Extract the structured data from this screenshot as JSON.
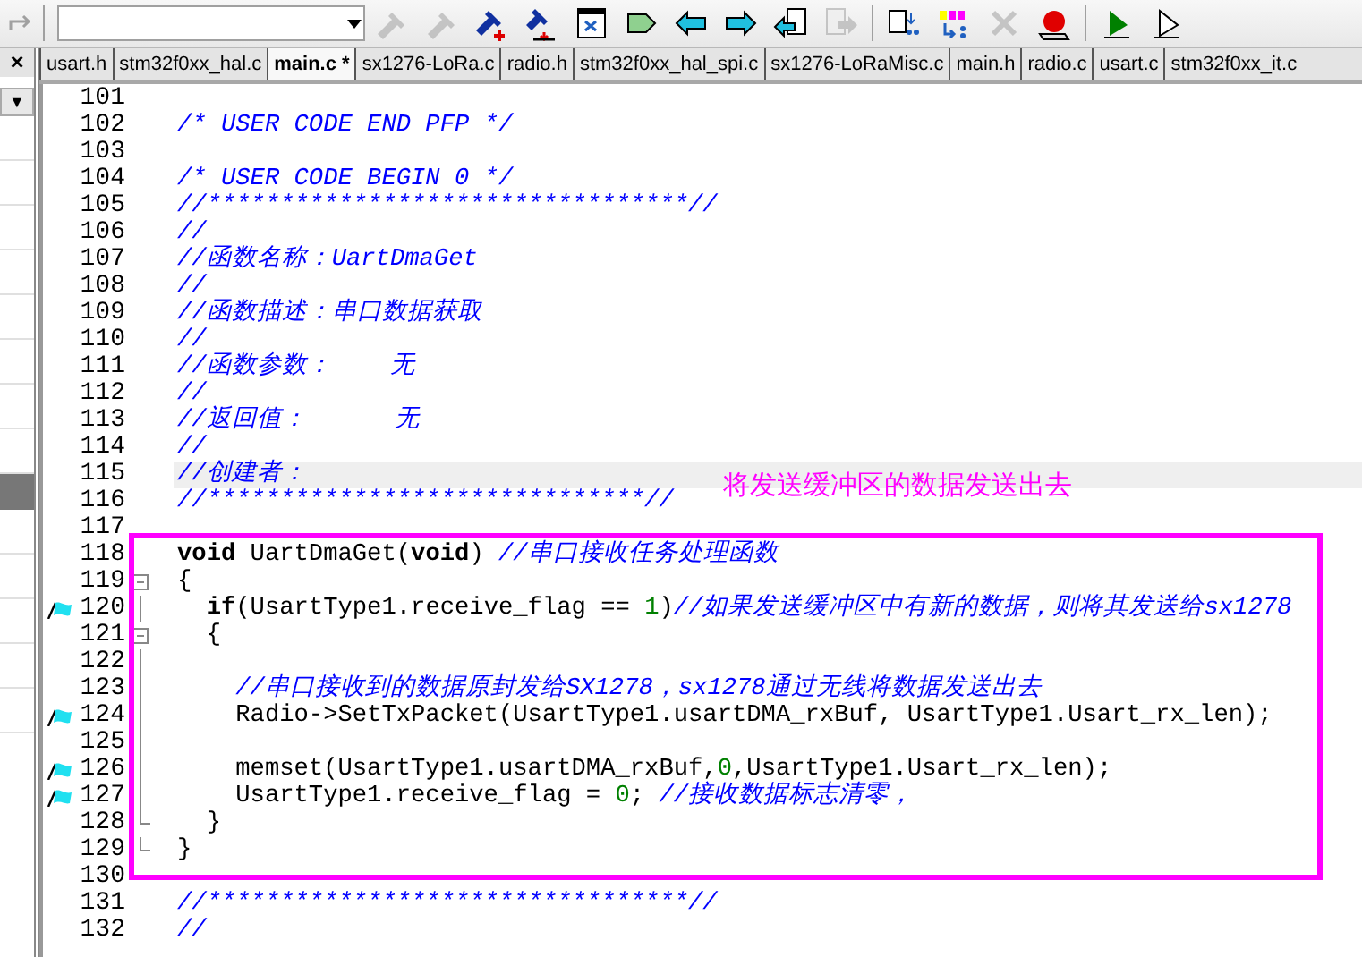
{
  "toolbar": {
    "redo_disabled": true,
    "icons": [
      {
        "kind": "flashlight",
        "disabled": true
      },
      {
        "kind": "flashlight",
        "disabled": true
      },
      {
        "kind": "flashlight-add",
        "disabled": false
      },
      {
        "kind": "flashlight-remove",
        "disabled": false
      },
      {
        "kind": "window",
        "disabled": false
      },
      {
        "kind": "tag",
        "disabled": false
      },
      {
        "kind": "arrow-left",
        "disabled": false
      },
      {
        "kind": "arrow-right",
        "disabled": false
      },
      {
        "kind": "doc-left",
        "disabled": false
      },
      {
        "kind": "doc-right",
        "disabled": true
      },
      {
        "kind": "separator"
      },
      {
        "kind": "doc-list",
        "disabled": false
      },
      {
        "kind": "bits",
        "disabled": false
      },
      {
        "kind": "cross",
        "disabled": true
      },
      {
        "kind": "record",
        "disabled": false
      },
      {
        "kind": "separator"
      },
      {
        "kind": "play",
        "disabled": false
      },
      {
        "kind": "play-outline",
        "disabled": false
      }
    ]
  },
  "left_panel": {
    "close": "×",
    "dropdown": "▼"
  },
  "tabs": [
    {
      "label": "usart.h",
      "selected": false
    },
    {
      "label": "stm32f0xx_hal.c",
      "selected": false
    },
    {
      "label": "main.c *",
      "selected": true
    },
    {
      "label": "sx1276-LoRa.c",
      "selected": false
    },
    {
      "label": "radio.h",
      "selected": false
    },
    {
      "label": "stm32f0xx_hal_spi.c",
      "selected": false
    },
    {
      "label": "sx1276-LoRaMisc.c",
      "selected": false
    },
    {
      "label": "main.h",
      "selected": false
    },
    {
      "label": "radio.c",
      "selected": false
    },
    {
      "label": "usart.c",
      "selected": false
    },
    {
      "label": "stm32f0xx_it.c",
      "selected": false
    }
  ],
  "editor": {
    "blocks": [
      {
        "kind": "plain",
        "lines": [
          {
            "number": "101",
            "kind": "plain",
            "bookmark": false,
            "current": false
          },
          {
            "number": "102",
            "kind": "plain",
            "bookmark": false,
            "current": false,
            "segments": [
              {
                "kind": "comment",
                "text": "/* USER CODE END PFP */"
              }
            ]
          },
          {
            "number": "103",
            "kind": "plain",
            "bookmark": false,
            "current": false
          },
          {
            "number": "104",
            "kind": "plain",
            "bookmark": false,
            "current": false,
            "segments": [
              {
                "kind": "comment",
                "text": "/* USER CODE BEGIN 0 */"
              }
            ]
          },
          {
            "number": "105",
            "kind": "plain",
            "bookmark": false,
            "current": false,
            "segments": [
              {
                "kind": "comment",
                "text": "//*********************************//"
              }
            ]
          },
          {
            "number": "106",
            "kind": "plain",
            "bookmark": false,
            "current": false,
            "segments": [
              {
                "kind": "comment",
                "text": "//"
              }
            ]
          },
          {
            "number": "107",
            "kind": "plain",
            "bookmark": false,
            "current": false,
            "segments": [
              {
                "kind": "comment",
                "text": "//函数名称：UartDmaGet"
              }
            ]
          },
          {
            "number": "108",
            "kind": "plain",
            "bookmark": false,
            "current": false,
            "segments": [
              {
                "kind": "comment",
                "text": "//"
              }
            ]
          },
          {
            "number": "109",
            "kind": "plain",
            "bookmark": false,
            "current": false,
            "segments": [
              {
                "kind": "comment",
                "text": "//函数描述：串口数据获取"
              }
            ]
          },
          {
            "number": "110",
            "kind": "plain",
            "bookmark": false,
            "current": false,
            "segments": [
              {
                "kind": "comment",
                "text": "//"
              }
            ]
          },
          {
            "number": "111",
            "kind": "plain",
            "bookmark": false,
            "current": false,
            "segments": [
              {
                "kind": "comment",
                "text": "//函数参数：    无"
              }
            ]
          },
          {
            "number": "112",
            "kind": "plain",
            "bookmark": false,
            "current": false,
            "segments": [
              {
                "kind": "comment",
                "text": "//"
              }
            ]
          },
          {
            "number": "113",
            "kind": "plain",
            "bookmark": false,
            "current": false,
            "segments": [
              {
                "kind": "comment",
                "text": "//返回值：      无"
              }
            ]
          },
          {
            "number": "114",
            "kind": "plain",
            "bookmark": false,
            "current": false,
            "segments": [
              {
                "kind": "comment",
                "text": "//"
              }
            ]
          },
          {
            "number": "115",
            "kind": "plain",
            "bookmark": false,
            "current": true,
            "segments": [
              {
                "kind": "comment",
                "text": "//创建者："
              }
            ]
          },
          {
            "number": "116",
            "kind": "plain",
            "bookmark": false,
            "current": false,
            "segments": [
              {
                "kind": "comment",
                "text": "//******************************//"
              }
            ]
          },
          {
            "number": "117",
            "kind": "plain",
            "bookmark": false,
            "current": false
          }
        ]
      },
      {
        "kind": "highlighted",
        "lines": [
          {
            "number": "118",
            "kind": "plain",
            "bookmark": false,
            "current": false,
            "segments": [
              {
                "kind": "keyword",
                "text": "void"
              },
              {
                "kind": "plain",
                "text": " UartDmaGet("
              },
              {
                "kind": "keyword",
                "text": "void"
              },
              {
                "kind": "plain",
                "text": ") "
              },
              {
                "kind": "comment",
                "text": "//串口接收任务处理函数"
              }
            ]
          },
          {
            "number": "119",
            "kind": "fold-start",
            "bookmark": false,
            "current": false,
            "segments": [
              {
                "kind": "plain",
                "text": "{"
              }
            ]
          },
          {
            "number": "120",
            "kind": "fold-inner",
            "bookmark": true,
            "current": false,
            "segments": [
              {
                "kind": "keyword",
                "text": "  if"
              },
              {
                "kind": "plain",
                "text": "(UsartType1.receive_flag == "
              },
              {
                "kind": "number",
                "text": "1"
              },
              {
                "kind": "plain",
                "text": ")"
              },
              {
                "kind": "comment",
                "text": "//如果发送缓冲区中有新的数据，则将其发送给sx1278"
              }
            ]
          },
          {
            "number": "121",
            "kind": "fold-start",
            "bookmark": false,
            "current": false,
            "segments": [
              {
                "kind": "plain",
                "text": "  {"
              }
            ]
          },
          {
            "number": "122",
            "kind": "fold-inner",
            "bookmark": false,
            "current": false
          },
          {
            "number": "123",
            "kind": "fold-inner",
            "bookmark": false,
            "current": false,
            "segments": [
              {
                "kind": "comment",
                "text": "    //串口接收到的数据原封发给SX1278，sx1278通过无线将数据发送出去"
              }
            ]
          },
          {
            "number": "124",
            "kind": "fold-inner",
            "bookmark": true,
            "current": false,
            "segments": [
              {
                "kind": "plain",
                "text": "    Radio->SetTxPacket(UsartType1.usartDMA_rxBuf, UsartType1.Usart_rx_len);"
              }
            ]
          },
          {
            "number": "125",
            "kind": "fold-inner",
            "bookmark": false,
            "current": false
          },
          {
            "number": "126",
            "kind": "fold-inner",
            "bookmark": true,
            "current": false,
            "segments": [
              {
                "kind": "plain",
                "text": "    memset(UsartType1.usartDMA_rxBuf,"
              },
              {
                "kind": "number",
                "text": "0"
              },
              {
                "kind": "plain",
                "text": ",UsartType1.Usart_rx_len);"
              }
            ]
          },
          {
            "number": "127",
            "kind": "fold-inner",
            "bookmark": true,
            "current": false,
            "segments": [
              {
                "kind": "plain",
                "text": "    UsartType1.receive_flag = "
              },
              {
                "kind": "number",
                "text": "0"
              },
              {
                "kind": "plain",
                "text": "; "
              },
              {
                "kind": "comment",
                "text": "//接收数据标志清零，"
              }
            ]
          },
          {
            "number": "128",
            "kind": "fold-end",
            "bookmark": false,
            "current": false,
            "segments": [
              {
                "kind": "plain",
                "text": "  }"
              }
            ]
          },
          {
            "number": "129",
            "kind": "fold-end",
            "bookmark": false,
            "current": false,
            "segments": [
              {
                "kind": "plain",
                "text": "}"
              }
            ]
          }
        ]
      },
      {
        "kind": "plain",
        "lines": [
          {
            "number": "130",
            "kind": "plain",
            "bookmark": false,
            "current": false
          },
          {
            "number": "131",
            "kind": "plain",
            "bookmark": false,
            "current": false,
            "segments": [
              {
                "kind": "comment",
                "text": "//*********************************//"
              }
            ]
          },
          {
            "number": "132",
            "kind": "plain",
            "bookmark": false,
            "current": false,
            "segments": [
              {
                "kind": "comment",
                "text": "//"
              }
            ]
          }
        ]
      }
    ]
  },
  "annotation": {
    "note": "将发送缓冲区的数据发送出去"
  }
}
